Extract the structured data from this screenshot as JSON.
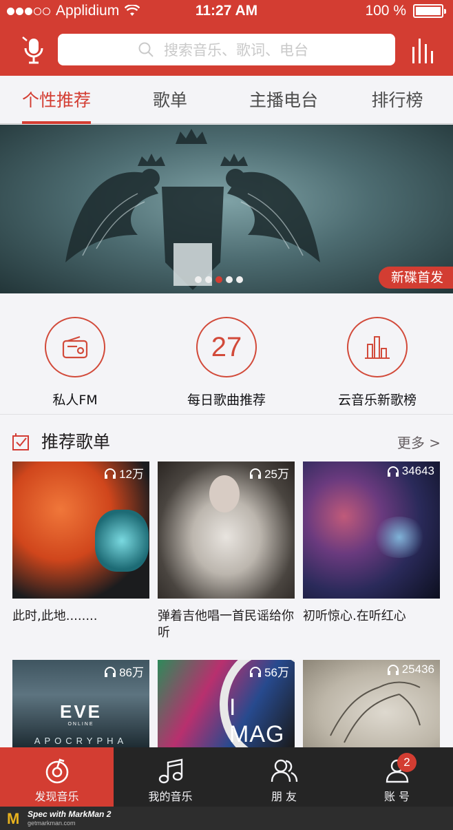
{
  "status_bar": {
    "carrier": "Applidium",
    "time": "11:27 AM",
    "battery": "100 %",
    "battery_level": 1.0,
    "signal_dots_filled": 3,
    "signal_dots_total": 5
  },
  "header": {
    "search_placeholder": "搜索音乐、歌词、电台",
    "left_icon": "voice-mic-icon",
    "right_icon": "equalizer-bars-icon",
    "bg_color": "#d33d32"
  },
  "tabs": [
    {
      "label": "个性推荐",
      "active": true
    },
    {
      "label": "歌单",
      "active": false
    },
    {
      "label": "主播电台",
      "active": false
    },
    {
      "label": "排行榜",
      "active": false
    }
  ],
  "banner": {
    "badge": "新碟首发",
    "dots_total": 5,
    "dots_active": 3
  },
  "quick_entries": [
    {
      "label": "私人FM",
      "icon": "radio-icon"
    },
    {
      "label": "每日歌曲推荐",
      "number": "27"
    },
    {
      "label": "云音乐新歌榜",
      "icon": "chart-bars-icon"
    }
  ],
  "section": {
    "title": "推荐歌单",
    "more": "更多 >"
  },
  "playlists": [
    {
      "count": "12万",
      "title": "此时,此地........"
    },
    {
      "count": "25万",
      "title": "弹着吉他唱一首民谣给你听"
    },
    {
      "count": "34643",
      "title": "初听惊心.在听红心"
    },
    {
      "count": "86万",
      "title": "",
      "cover_text": "EVE",
      "cover_sub": "ONLINE",
      "cover_caption": "APOCRYPHA"
    },
    {
      "count": "56万",
      "title": "",
      "cover_text": "I MAG"
    },
    {
      "count": "25436",
      "title": ""
    }
  ],
  "tab_bar": [
    {
      "label": "发现音乐",
      "icon": "netease-music-icon",
      "active": true
    },
    {
      "label": "我的音乐",
      "icon": "music-note-icon",
      "active": false
    },
    {
      "label": "朋 友",
      "icon": "friends-icon",
      "active": false
    },
    {
      "label": "账 号",
      "icon": "account-icon",
      "active": false,
      "badge": "2"
    }
  ],
  "footer": {
    "logo": "M",
    "text": "Spec with MarkMan 2",
    "sub": "getmarkman.com"
  },
  "colors": {
    "brand_red": "#d33d32",
    "icon_red": "#d24a3a",
    "title_text": "#201d1e",
    "body_text": "#111114",
    "muted_text": "#655e61",
    "tab_text": "#4c4c4c",
    "divider": "#cbcaca",
    "page_bg": "#f4f4f7"
  }
}
